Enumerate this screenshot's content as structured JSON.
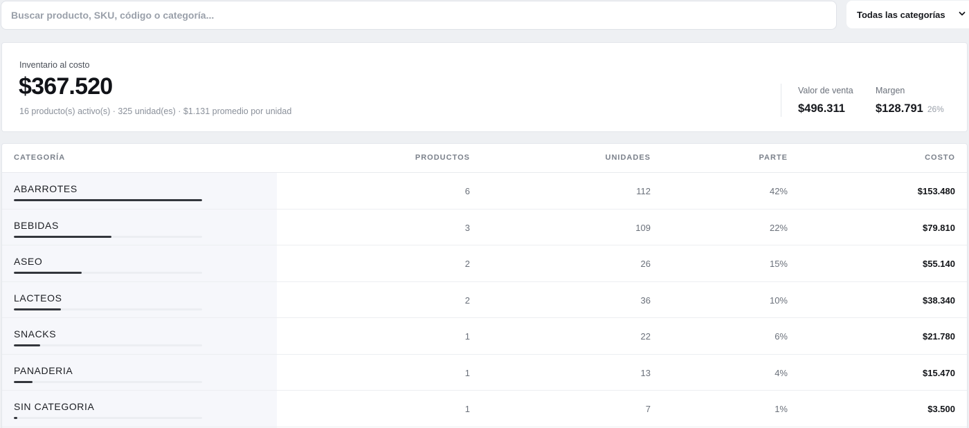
{
  "search": {
    "placeholder": "Buscar producto, SKU, código o categoría..."
  },
  "category_filter": {
    "selected": "Todas las categorías",
    "icon": "chevron-down-icon"
  },
  "summary": {
    "label": "Inventario al costo",
    "value": "$367.520",
    "subtitle": "16 producto(s) activo(s) · 325 unidad(es) · $1.131 promedio por unidad",
    "sale_value_label": "Valor de venta",
    "sale_value": "$496.311",
    "margin_label": "Margen",
    "margin": "$128.791",
    "margin_pct": "26%"
  },
  "table": {
    "headers": {
      "category": "CATEGORÍA",
      "products": "PRODUCTOS",
      "units": "UNIDADES",
      "share": "PARTE",
      "cost": "COSTO"
    },
    "rows": [
      {
        "category": "ABARROTES",
        "products": "6",
        "units": "112",
        "share": "42%",
        "cost": "$153.480",
        "bar_fraction": 1.0
      },
      {
        "category": "BEBIDAS",
        "products": "3",
        "units": "109",
        "share": "22%",
        "cost": "$79.810",
        "bar_fraction": 0.52
      },
      {
        "category": "ASEO",
        "products": "2",
        "units": "26",
        "share": "15%",
        "cost": "$55.140",
        "bar_fraction": 0.36
      },
      {
        "category": "LACTEOS",
        "products": "2",
        "units": "36",
        "share": "10%",
        "cost": "$38.340",
        "bar_fraction": 0.25
      },
      {
        "category": "SNACKS",
        "products": "1",
        "units": "22",
        "share": "6%",
        "cost": "$21.780",
        "bar_fraction": 0.14
      },
      {
        "category": "PANADERIA",
        "products": "1",
        "units": "13",
        "share": "4%",
        "cost": "$15.470",
        "bar_fraction": 0.1
      },
      {
        "category": "SIN CATEGORIA",
        "products": "1",
        "units": "7",
        "share": "1%",
        "cost": "$3.500",
        "bar_fraction": 0.02
      }
    ]
  }
}
